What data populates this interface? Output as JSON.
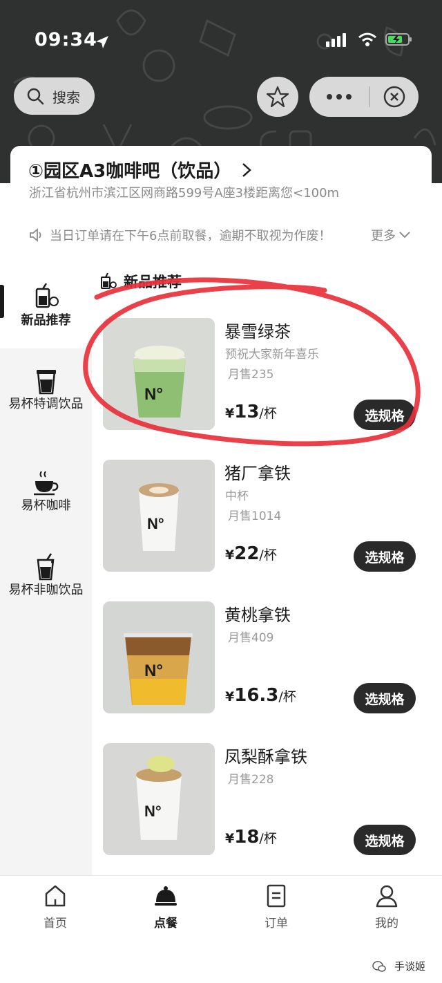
{
  "status_bar": {
    "time": "09:34"
  },
  "header": {
    "search_label": "搜索"
  },
  "store": {
    "name": "①园区A3咖啡吧（饮品）",
    "address": "浙江省杭州市滨江区网商路599号A座3楼距离您<100m",
    "notice": "当日订单请在下午6点前取餐，逾期不取视为作废！",
    "more": "更多"
  },
  "sidebar": {
    "items": [
      {
        "label": "新品推荐",
        "icon": "new-drink-icon",
        "active": true
      },
      {
        "label": "易杯特调饮品",
        "icon": "cup-icon",
        "active": false
      },
      {
        "label": "易杯咖啡",
        "icon": "coffee-icon",
        "active": false
      },
      {
        "label": "易杯非咖饮品",
        "icon": "soda-icon",
        "active": false
      }
    ]
  },
  "section": {
    "title": "新品推荐"
  },
  "products": [
    {
      "name": "暴雪绿茶",
      "subtitle": "预祝大家新年喜乐",
      "sales": "月售235",
      "currency": "¥",
      "price": "13",
      "unit": "/杯",
      "button": "选规格"
    },
    {
      "name": "猪厂拿铁",
      "subtitle": "中杯",
      "sales": "月售1014",
      "currency": "¥",
      "price": "22",
      "unit": "/杯",
      "button": "选规格"
    },
    {
      "name": "黄桃拿铁",
      "subtitle": "",
      "sales": "月售409",
      "currency": "¥",
      "price": "16.3",
      "unit": "/杯",
      "button": "选规格"
    },
    {
      "name": "凤梨酥拿铁",
      "subtitle": "",
      "sales": "月售228",
      "currency": "¥",
      "price": "18",
      "unit": "/杯",
      "button": "选规格"
    }
  ],
  "tabbar": {
    "items": [
      {
        "label": "首页",
        "icon": "home-icon"
      },
      {
        "label": "点餐",
        "icon": "cloche-icon",
        "active": true
      },
      {
        "label": "订单",
        "icon": "order-icon"
      },
      {
        "label": "我的",
        "icon": "profile-icon"
      }
    ]
  },
  "watermark": {
    "text": "手谈姬"
  },
  "colors": {
    "header_bg": "#2f3130",
    "button_bg": "#2a2a2a",
    "annotation_red": "#e8303a"
  }
}
